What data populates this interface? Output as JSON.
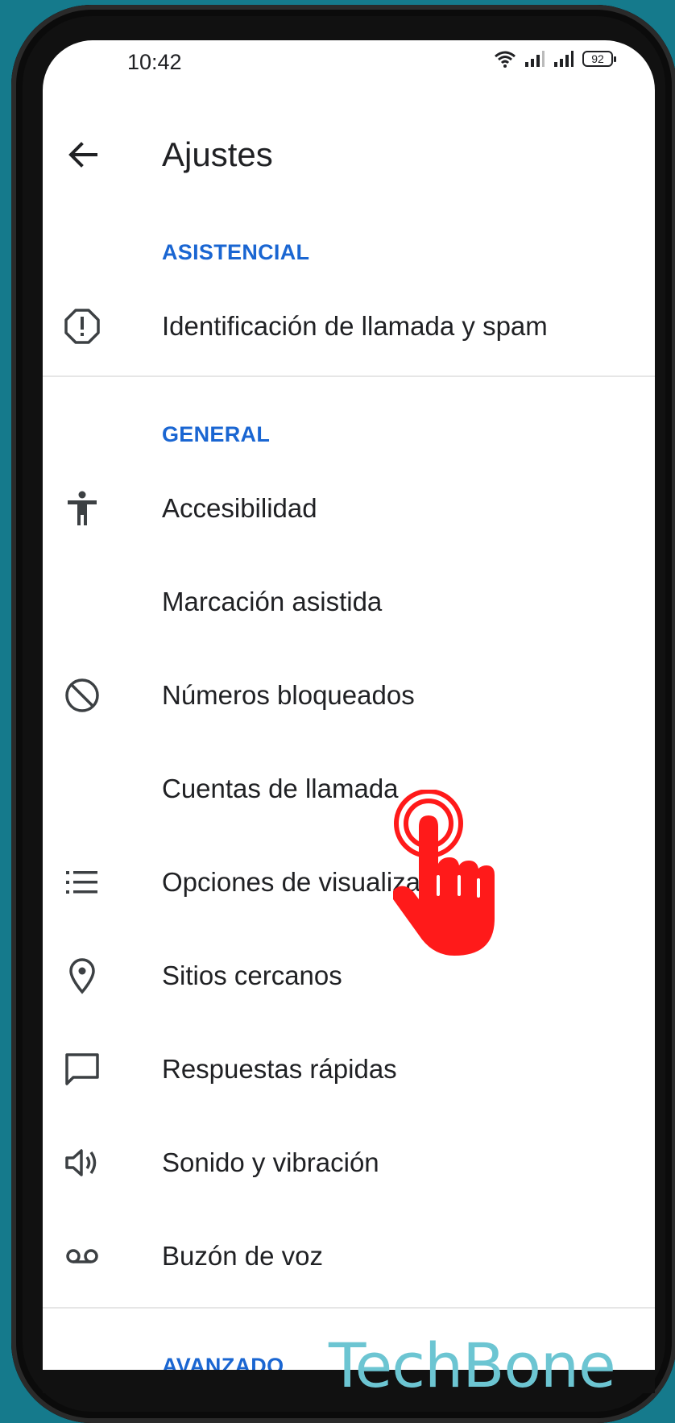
{
  "status_bar": {
    "time": "10:42",
    "battery": "92"
  },
  "header": {
    "back_icon": "arrow-left-icon",
    "title": "Ajustes"
  },
  "sections": {
    "asistencial": {
      "header": "ASISTENCIAL",
      "items": [
        {
          "label": "Identificación de llamada y spam",
          "icon": "alert-circle-icon"
        }
      ]
    },
    "general": {
      "header": "GENERAL",
      "items": [
        {
          "label": "Accesibilidad",
          "icon": "accessibility-icon"
        },
        {
          "label": "Marcación asistida",
          "icon": ""
        },
        {
          "label": "Números bloqueados",
          "icon": "block-icon"
        },
        {
          "label": "Cuentas de llamada",
          "icon": ""
        },
        {
          "label": "Opciones de visualización",
          "icon": "list-icon"
        },
        {
          "label": "Sitios cercanos",
          "icon": "location-pin-icon"
        },
        {
          "label": "Respuestas rápidas",
          "icon": "chat-bubble-icon"
        },
        {
          "label": "Sonido y vibración",
          "icon": "volume-icon"
        },
        {
          "label": "Buzón de voz",
          "icon": "voicemail-icon"
        }
      ]
    },
    "avanzado": {
      "header": "AVANZADO"
    }
  },
  "overlay": {
    "watermark": "TechBone",
    "cursor_icon": "tap-hand-icon",
    "accent_color": "#1a66d2",
    "cursor_color": "#ff1a1a"
  }
}
